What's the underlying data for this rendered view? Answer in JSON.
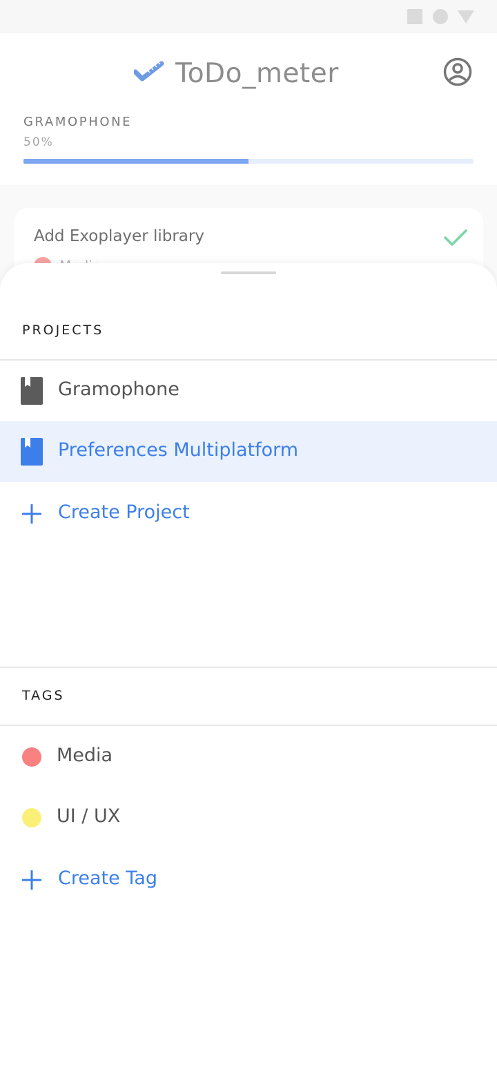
{
  "app": {
    "title": "ToDo_meter",
    "logo_icon": "ruler-check-icon",
    "profile_icon": "account-circle-icon"
  },
  "current_project": {
    "name": "GRAMOPHONE",
    "progress_text": "50%",
    "progress_fraction": 0.5
  },
  "task_card": {
    "title": "Add Exoplayer library",
    "tag": "Media",
    "completed": true
  },
  "sheet": {
    "projects_header": "PROJECTS",
    "projects": [
      {
        "label": "Gramophone",
        "selected": false
      },
      {
        "label": "Preferences Multiplatform",
        "selected": true
      }
    ],
    "create_project_label": "Create Project",
    "tags_header": "TAGS",
    "tags": [
      {
        "label": "Media",
        "color": "#f98181"
      },
      {
        "label": "UI / UX",
        "color": "#fbf077"
      }
    ],
    "create_tag_label": "Create Tag"
  },
  "colors": {
    "accent": "#3d7fea",
    "selected_bg": "#ebf2fd",
    "progress_fill": "#7ea5ef",
    "check": "#7ad6a4"
  }
}
